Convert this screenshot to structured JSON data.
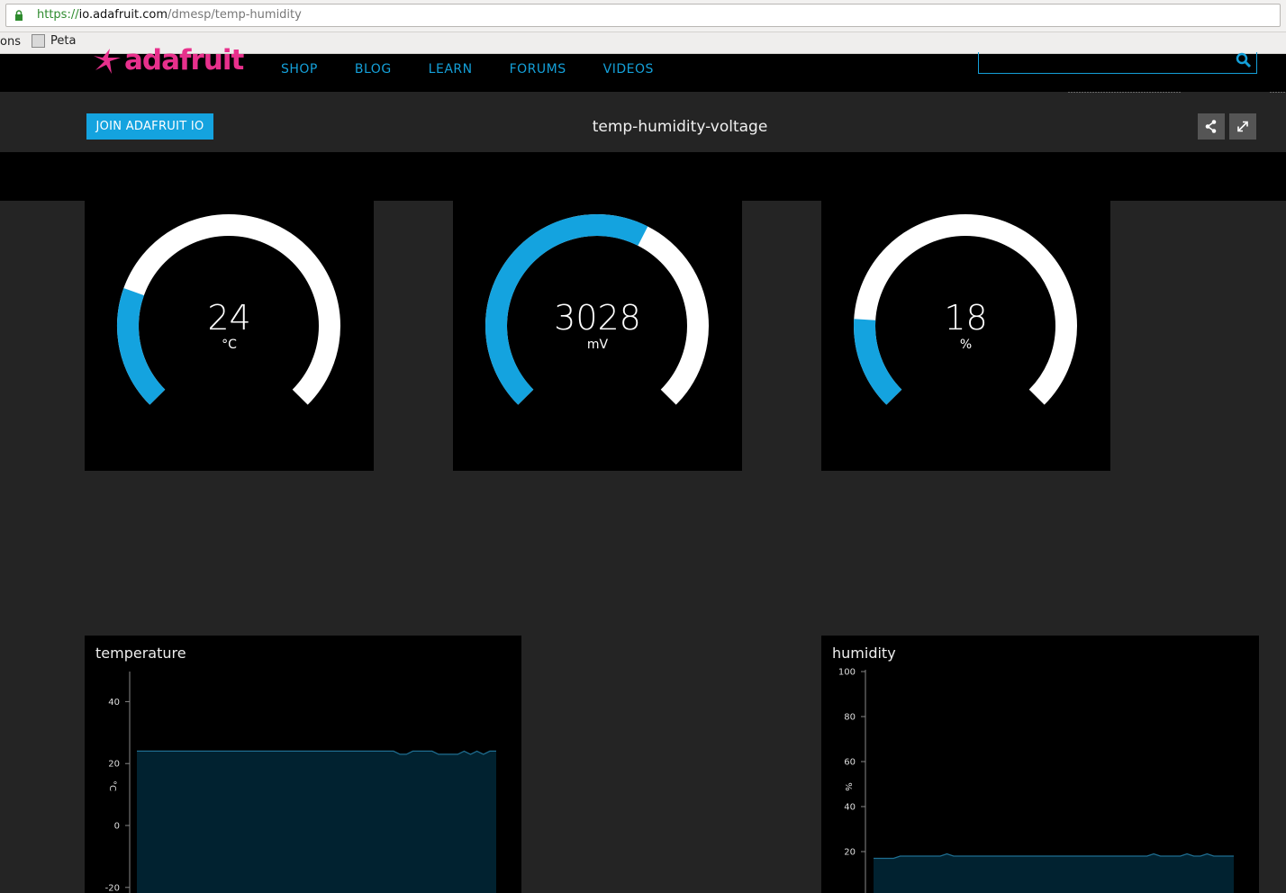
{
  "browser": {
    "url_scheme": "https://",
    "url_host": "io.adafruit.com",
    "url_path": "/dmesp/temp-humidity",
    "bookmark_partial": "ons",
    "bookmark_label": "Peta"
  },
  "header": {
    "logo_text": "adafruit",
    "nav": [
      "SHOP",
      "BLOG",
      "LEARN",
      "FORUMS",
      "VIDEOS"
    ],
    "search_value": ""
  },
  "dashboard": {
    "join_label": "JOIN ADAFRUIT IO",
    "title": "temp-humidity-voltage",
    "share_icon": "share-icon",
    "fullscreen_icon": "fullscreen-icon"
  },
  "gauges": [
    {
      "value": "24",
      "unit": "°C",
      "fill_fraction": 0.24
    },
    {
      "value": "3028",
      "unit": "mV",
      "fill_fraction": 0.6
    },
    {
      "value": "18",
      "unit": "%",
      "fill_fraction": 0.18
    }
  ],
  "colors": {
    "accent": "#14a3df",
    "logo": "#e8308c",
    "background": "#242424",
    "chart_fill": "#012230",
    "chart_line": "#1f6e91"
  },
  "chart_data": [
    {
      "type": "area",
      "title": "temperature",
      "ylabel": "°C",
      "yticks": [
        "40",
        "20",
        "0",
        "-20"
      ],
      "ylim": [
        -20,
        50
      ],
      "values": [
        24,
        24,
        24,
        24,
        24,
        24,
        24,
        24,
        24,
        24,
        24,
        24,
        24,
        24,
        24,
        24,
        24,
        24,
        24,
        24,
        24,
        24,
        24,
        24,
        24,
        24,
        24,
        24,
        24,
        24,
        24,
        24,
        24,
        24,
        24,
        24,
        24,
        24,
        24,
        24,
        24,
        23,
        23,
        24,
        24,
        24,
        24,
        23,
        23,
        23,
        23,
        24,
        23,
        24,
        23,
        24,
        24
      ]
    },
    {
      "type": "area",
      "title": "humidity",
      "ylabel": "%",
      "yticks": [
        "100",
        "80",
        "60",
        "40",
        "20"
      ],
      "ylim": [
        0,
        100
      ],
      "values": [
        17,
        17,
        17,
        17,
        18,
        18,
        18,
        18,
        18,
        18,
        18,
        19,
        18,
        18,
        18,
        18,
        18,
        18,
        18,
        18,
        18,
        18,
        18,
        18,
        18,
        18,
        18,
        18,
        18,
        18,
        18,
        18,
        18,
        18,
        18,
        18,
        18,
        18,
        18,
        18,
        18,
        18,
        19,
        18,
        18,
        18,
        18,
        19,
        18,
        18,
        19,
        18,
        18,
        18,
        18
      ]
    }
  ]
}
